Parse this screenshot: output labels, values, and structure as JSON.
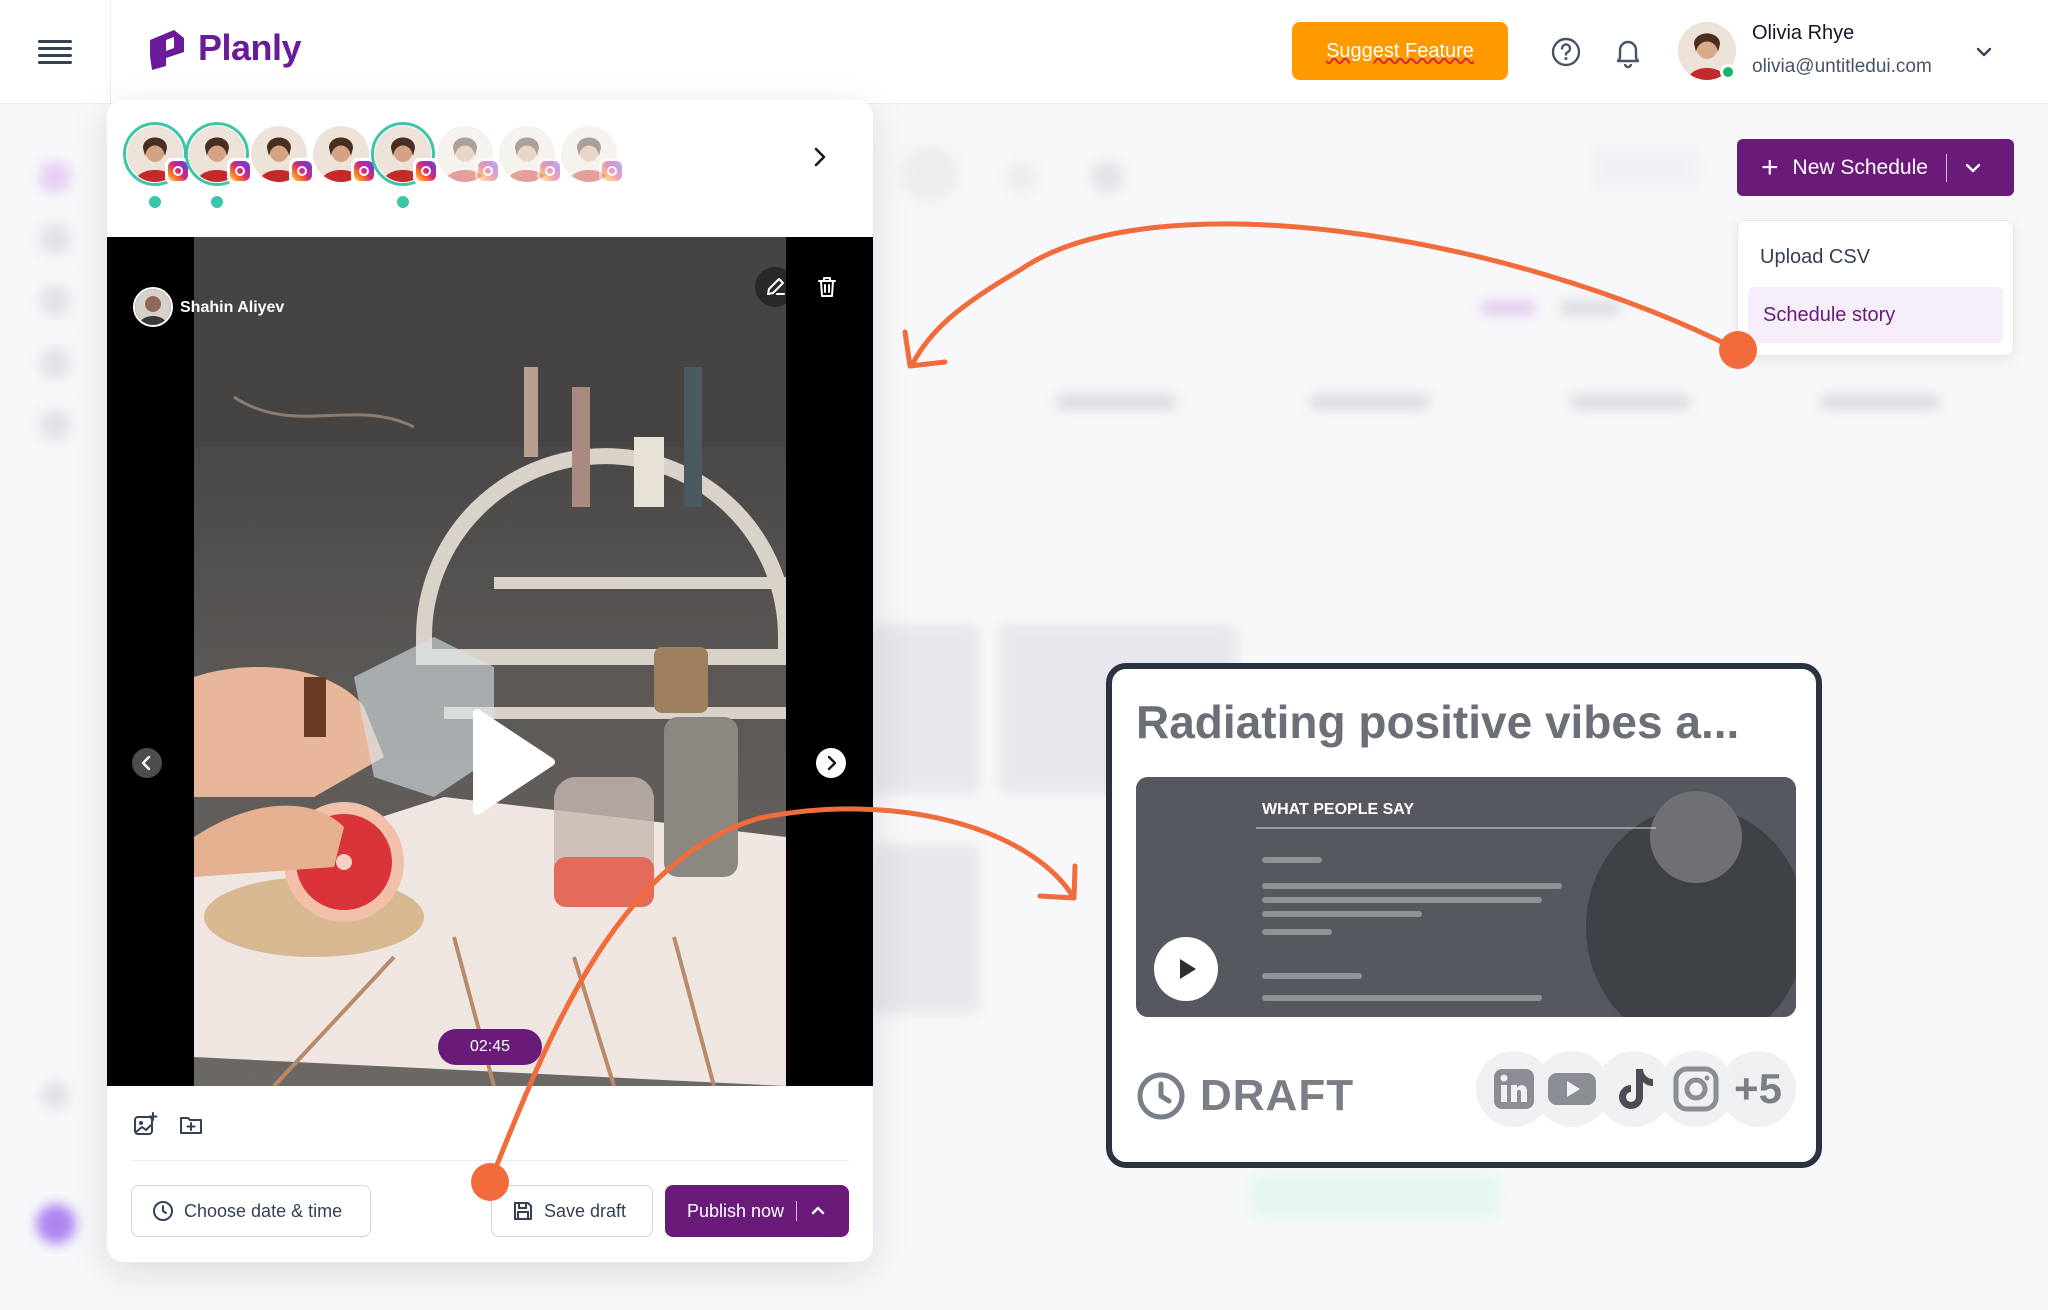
{
  "app": {
    "name": "Planly"
  },
  "header": {
    "suggest_label": "Suggest Feature",
    "user": {
      "name": "Olivia Rhye",
      "email": "olivia@untitledui.com"
    }
  },
  "schedule": {
    "new_label": "New Schedule",
    "menu": [
      "Upload CSV",
      "Schedule story"
    ]
  },
  "story": {
    "author": "Shahin Aliyev",
    "duration": "02:45",
    "choose_label": "Choose date & time",
    "save_label": "Save draft",
    "publish_label": "Publish now",
    "accounts": [
      {
        "platform": "instagram",
        "active": true
      },
      {
        "platform": "instagram",
        "active": true
      },
      {
        "platform": "instagram",
        "active": false
      },
      {
        "platform": "instagram",
        "active": false
      },
      {
        "platform": "instagram",
        "active": true
      },
      {
        "platform": "instagram",
        "active": false,
        "dimmed": true
      },
      {
        "platform": "instagram",
        "active": false,
        "dimmed": true
      },
      {
        "platform": "instagram",
        "active": false,
        "dimmed": true
      }
    ]
  },
  "preview": {
    "title": "Radiating positive vibes a...",
    "media_heading": "WHAT PEOPLE SAY",
    "status": "DRAFT",
    "more_platforms": "+5",
    "platforms": [
      "linkedin-icon",
      "youtube-icon",
      "tiktok-icon",
      "instagram-icon"
    ]
  },
  "colors": {
    "brand": "#6a1b7a",
    "accent": "#ff9900",
    "annotation": "#f26b3a",
    "active_ring": "#3cc6a8"
  }
}
